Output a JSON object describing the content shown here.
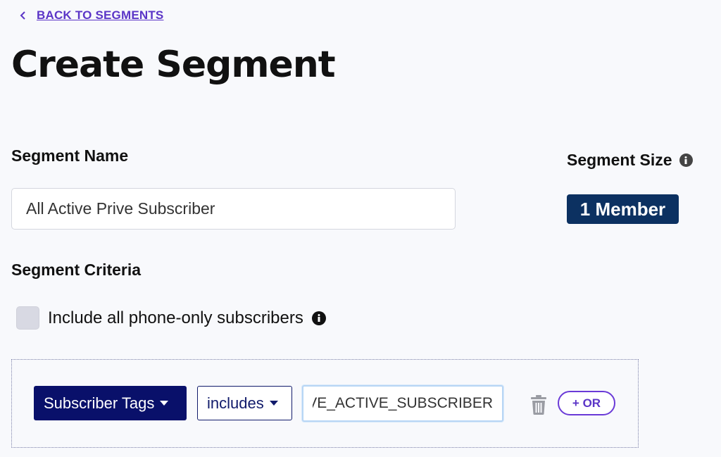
{
  "back_link": {
    "label": "BACK TO SEGMENTS",
    "icon": "chevron-left-icon"
  },
  "page_title": "Create Segment",
  "segment_name": {
    "label": "Segment Name",
    "value": "All Active Prive Subscriber"
  },
  "segment_size": {
    "label": "Segment Size",
    "info_icon": "info-icon",
    "badge": "1 Member"
  },
  "segment_criteria": {
    "label": "Segment Criteria",
    "include_phone_only": {
      "label": "Include all phone-only subscribers",
      "checked": false,
      "info_icon": "info-icon"
    },
    "rule": {
      "field": "Subscriber Tags",
      "operator": "includes",
      "value": "VE_ACTIVE_SUBSCRIBER",
      "delete_icon": "trash-icon",
      "or_button": "+ OR"
    }
  },
  "colors": {
    "accent": "#5b35c7",
    "badge_bg": "#0c3161",
    "field_dropdown_bg": "#09106a",
    "page_bg": "#f8f9fc"
  }
}
